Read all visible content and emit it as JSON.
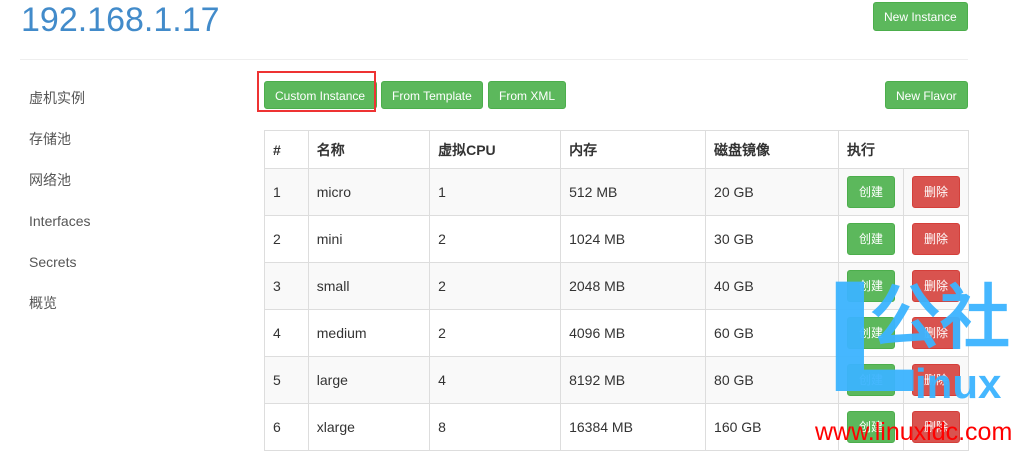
{
  "header": {
    "title": "192.168.1.17",
    "new_instance": "New Instance"
  },
  "sidebar": {
    "items": [
      "虚机实例",
      "存储池",
      "网络池",
      "Interfaces",
      "Secrets",
      "概览"
    ]
  },
  "toolbar": {
    "custom": "Custom Instance",
    "template": "From Template",
    "xml": "From XML",
    "new_flavor": "New Flavor"
  },
  "table": {
    "headers": [
      "#",
      "名称",
      "虚拟CPU",
      "内存",
      "磁盘镜像",
      "执行"
    ],
    "rows": [
      [
        "1",
        "micro",
        "1",
        "512 MB",
        "20 GB"
      ],
      [
        "2",
        "mini",
        "2",
        "1024 MB",
        "30 GB"
      ],
      [
        "3",
        "small",
        "2",
        "2048 MB",
        "40 GB"
      ],
      [
        "4",
        "medium",
        "2",
        "4096 MB",
        "60 GB"
      ],
      [
        "5",
        "large",
        "4",
        "8192 MB",
        "80 GB"
      ],
      [
        "6",
        "xlarge",
        "8",
        "16384 MB",
        "160 GB"
      ]
    ],
    "create": "创建",
    "delete": "删除"
  },
  "watermark": {
    "logo": "Linux公社",
    "url": "www.linuxidc.com"
  }
}
